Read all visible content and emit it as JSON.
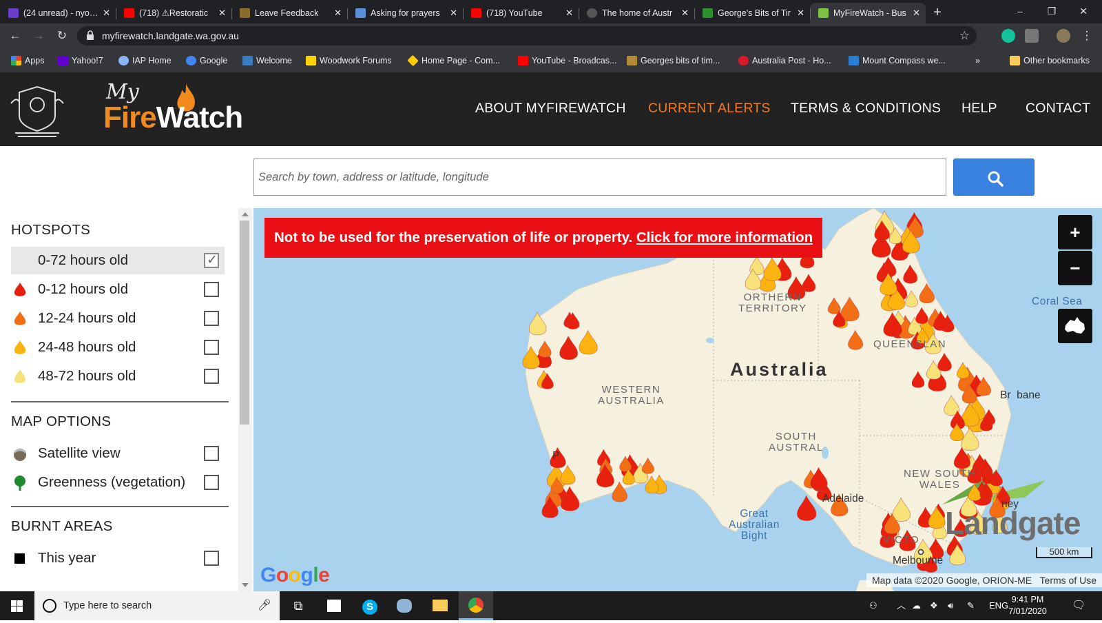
{
  "browser": {
    "tabs": [
      {
        "title": "(24 unread) - nyo…",
        "icon": "mail-icon",
        "color": "#6a3dc8",
        "active": false
      },
      {
        "title": "(718) ⚠Restoratic",
        "icon": "youtube-icon",
        "color": "#ff0000",
        "active": false
      },
      {
        "title": "Leave Feedback",
        "icon": "store-icon",
        "color": "#8a6d2c",
        "active": false
      },
      {
        "title": "Asking for prayers",
        "icon": "document-icon",
        "color": "#5b8fd6",
        "active": false
      },
      {
        "title": "(718) YouTube",
        "icon": "youtube-icon",
        "color": "#ff0000",
        "active": false
      },
      {
        "title": "The home of Austr",
        "icon": "globe-icon",
        "color": "#555555",
        "active": false
      },
      {
        "title": "George's Bits of Tir",
        "icon": "dollar-icon",
        "color": "#2f8f2f",
        "active": false
      },
      {
        "title": "MyFireWatch - Bus",
        "icon": "leaf-icon",
        "color": "#7cc143",
        "active": true
      }
    ],
    "url": "myfirewatch.landgate.wa.gov.au",
    "bookmarks": [
      {
        "label": "Apps",
        "icon": "apps-grid-icon",
        "color": "#ea4335"
      },
      {
        "label": "Yahoo!7",
        "icon": "yahoo-icon",
        "color": "#6001d2"
      },
      {
        "label": "IAP Home",
        "icon": "globe-icon",
        "color": "#8ab4f8"
      },
      {
        "label": "Google",
        "icon": "google-icon",
        "color": "#4285f4"
      },
      {
        "label": "Welcome",
        "icon": "paypal-icon",
        "color": "#3b7bbf"
      },
      {
        "label": "Woodwork Forums",
        "icon": "woodwork-icon",
        "color": "#ffd400"
      },
      {
        "label": "Home Page - Com...",
        "icon": "diamond-icon",
        "color": "#ffcc00"
      },
      {
        "label": "YouTube - Broadcas...",
        "icon": "youtube-icon",
        "color": "#ff0000"
      },
      {
        "label": "Georges bits of tim...",
        "icon": "store-icon",
        "color": "#b58b3a"
      },
      {
        "label": "Australia Post - Ho...",
        "icon": "auspost-icon",
        "color": "#dc1928"
      },
      {
        "label": "Mount Compass we...",
        "icon": "weatherzone-icon",
        "color": "#2a7fd4"
      }
    ],
    "bookmarks_more": "»",
    "other_bookmarks": "Other bookmarks"
  },
  "site": {
    "brand_my": "My",
    "brand_fire": "Fire",
    "brand_watch": "Watch",
    "nav": [
      {
        "label": "ABOUT MYFIREWATCH",
        "active": false
      },
      {
        "label": "CURRENT ALERTS",
        "active": true
      },
      {
        "label": "TERMS & CONDITIONS",
        "active": false
      },
      {
        "label": "HELP",
        "active": false
      },
      {
        "label": "CONTACT",
        "active": false
      }
    ],
    "search_placeholder": "Search by town, address or latitude, longitude",
    "accent": "#f47c20",
    "search_button_color": "#3a82e0"
  },
  "panel": {
    "hotspots_title": "HOTSPOTS",
    "hotspots": [
      {
        "label": "0-72 hours old",
        "checked": true,
        "icon": "none"
      },
      {
        "label": "0-12 hours old",
        "checked": false,
        "icon": "flame-red-icon",
        "color": "#e8210e"
      },
      {
        "label": "12-24 hours old",
        "checked": false,
        "icon": "flame-orange-icon",
        "color": "#f36f16"
      },
      {
        "label": "24-48 hours old",
        "checked": false,
        "icon": "flame-amber-icon",
        "color": "#fbb40f"
      },
      {
        "label": "48-72 hours old",
        "checked": false,
        "icon": "flame-yellow-icon",
        "color": "#f7e27a"
      }
    ],
    "map_options_title": "MAP OPTIONS",
    "map_options": [
      {
        "label": "Satellite view",
        "checked": false,
        "icon": "satellite-icon"
      },
      {
        "label": "Greenness (vegetation)",
        "checked": false,
        "icon": "tree-icon"
      }
    ],
    "burnt_title": "BURNT AREAS",
    "burnt": [
      {
        "label": "This year",
        "checked": false,
        "icon": "black-square-icon"
      }
    ]
  },
  "map": {
    "warning_text": "Not to be used for the preservation of life or property.",
    "warning_link": "Click for more information",
    "zoom_in": "+",
    "zoom_out": "−",
    "labels": {
      "australia": "Australia",
      "nt": "ORTHERN\nTERRITORY",
      "wa": "WESTERN\nAUSTRALIA",
      "sa": "SOUTH\nAUSTRAL",
      "qld": "QUEENSLAN",
      "nsw": "NEW SOUTH\nWALES",
      "vic": "VICTO",
      "coral_sea": "Coral Sea",
      "bight": "Great\nAustralian\nBight",
      "adelaide": "Adelaide",
      "melbourne": "Melbourne",
      "brisbane": "Br  bane",
      "perth": "P",
      "sydney": "ney"
    },
    "google": "Google",
    "attribution": "Map data ©2020 Google, ORION-ME",
    "terms": "Terms of Use",
    "scale": "500 km",
    "landgate": "Landgate"
  },
  "taskbar": {
    "search_placeholder": "Type here to search",
    "language": "ENG",
    "time": "9:41 PM",
    "date": "7/01/2020"
  }
}
